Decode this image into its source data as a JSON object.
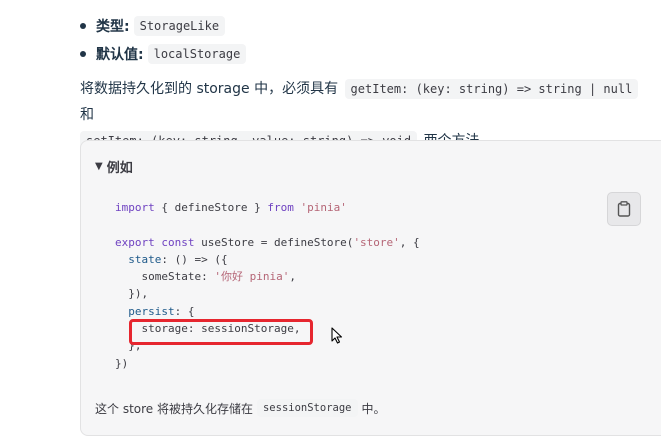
{
  "bullets": [
    {
      "label": "类型:",
      "value": "StorageLike"
    },
    {
      "label": "默认值:",
      "value": "localStorage"
    }
  ],
  "paragraph": {
    "text1": "将数据持久化到的 storage 中，必须具有",
    "code1": "getItem: (key: string) => string | null",
    "text2": "和",
    "code2": "setItem: (key: string, value: string) => void",
    "text3": "两个方法。"
  },
  "callout": {
    "title": "例如",
    "copy_icon": "clipboard-icon",
    "code": {
      "line1_kw1": "import",
      "line1_mid": " { defineStore } ",
      "line1_kw2": "from",
      "line1_str": " 'pinia'",
      "line3_kw1": "export const",
      "line3_mid": " useStore = defineStore(",
      "line3_str": "'store'",
      "line3_end": ", {",
      "line4_prop": "state",
      "line4_end": ": () => ({",
      "line5_key": "someState",
      "line5_colon": ": ",
      "line5_str": "'你好 pinia'",
      "line5_end": ",",
      "line6": "  }),",
      "line7_prop": "persist",
      "line7_end": ": {",
      "line8_key": "storage",
      "line8_end": ": sessionStorage,",
      "line9": "  },",
      "line10": "})"
    },
    "footer_text1": "这个 store 将被持久化存储在",
    "footer_code": "sessionStorage",
    "footer_text2": "中。"
  },
  "colors": {
    "highlight": "#e6262f",
    "callout_bg": "#f6f6f7"
  }
}
